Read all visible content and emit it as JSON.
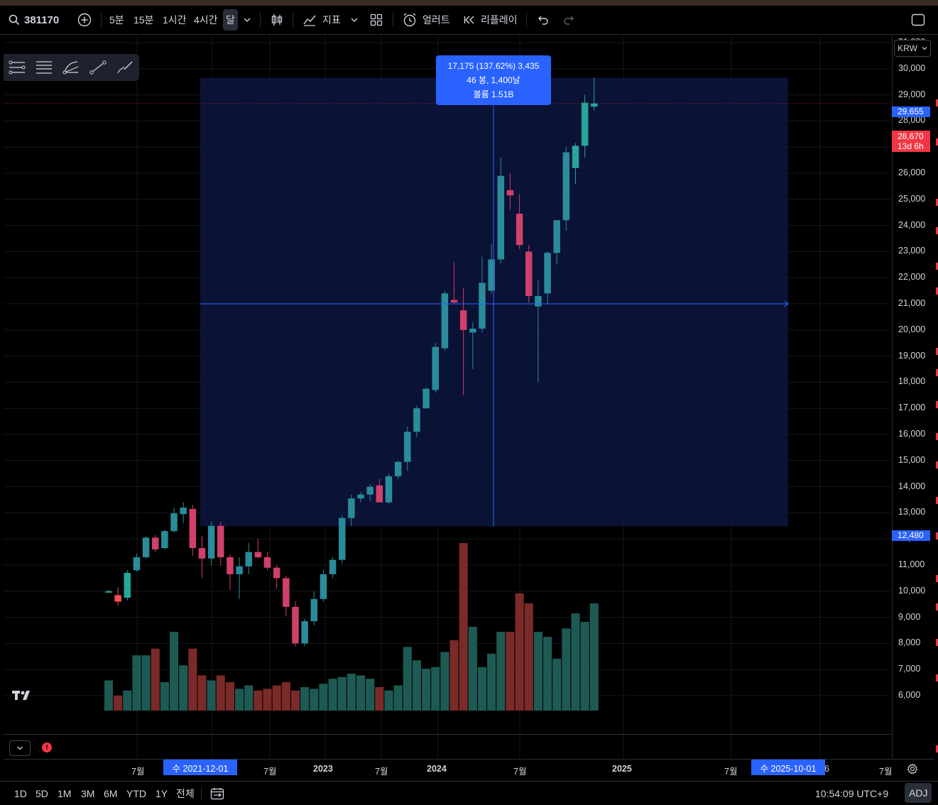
{
  "toolbar": {
    "symbol": "381170",
    "intervals": [
      "5분",
      "15분",
      "1시간",
      "4시간",
      "달"
    ],
    "active_interval": "달",
    "indicators_label": "지표",
    "alert_label": "얼러트",
    "replay_label": "리플레이"
  },
  "currency": "KRW",
  "measure_tooltip": {
    "line1": "17,175 (137.62%) 3,435",
    "line2": "46 봉, 1,400날",
    "line3": "볼륨 1.51B"
  },
  "price_axis": {
    "labels": [
      "31,000",
      "30,000",
      "29,000",
      "28,000",
      "27,000",
      "26,000",
      "25,000",
      "24,000",
      "23,000",
      "22,000",
      "21,000",
      "20,000",
      "19,000",
      "18,000",
      "17,000",
      "16,000",
      "15,000",
      "14,000",
      "13,000",
      "12,000",
      "11,000",
      "10,000",
      "9,000",
      "8,000",
      "7,000",
      "6,000"
    ],
    "high_tag": "29,655",
    "current_tag": "28,670",
    "countdown": "13d 6h",
    "low_tag": "12,480"
  },
  "time_axis": {
    "labels": [
      "7월",
      "7월",
      "2023",
      "7월",
      "2024",
      "7월",
      "2025",
      "7월",
      "6",
      "7월"
    ],
    "start_tag": "수 2021-12-01",
    "end_tag": "수 2025-10-01"
  },
  "bottom_bar": {
    "ranges": [
      "1D",
      "5D",
      "1M",
      "3M",
      "6M",
      "YTD",
      "1Y",
      "전체"
    ],
    "clock": "10:54:09 UTC+9",
    "adj_label": "ADJ"
  },
  "colors": {
    "up": "#26a69a",
    "down": "#ef5350",
    "selection": "#2962ff",
    "measure_fill": "#0c1540"
  },
  "chart_data": {
    "type": "candlestick",
    "interval": "1M",
    "x": [
      "2021-09",
      "2021-10",
      "2021-11",
      "2021-12",
      "2022-01",
      "2022-02",
      "2022-03",
      "2022-04",
      "2022-05",
      "2022-06",
      "2022-07",
      "2022-08",
      "2022-09",
      "2022-10",
      "2022-11",
      "2022-12",
      "2023-01",
      "2023-02",
      "2023-03",
      "2023-04",
      "2023-05",
      "2023-06",
      "2023-07",
      "2023-08",
      "2023-09",
      "2023-10",
      "2023-11",
      "2023-12",
      "2024-01",
      "2024-02",
      "2024-03",
      "2024-04",
      "2024-05",
      "2024-06",
      "2024-07",
      "2024-08",
      "2024-09",
      "2024-10",
      "2024-11",
      "2024-12",
      "2025-01",
      "2025-02",
      "2025-03",
      "2025-04",
      "2025-05",
      "2025-06",
      "2025-07",
      "2025-08",
      "2025-09",
      "2025-10"
    ],
    "ohlc": [
      [
        10000,
        10050,
        9950,
        10000
      ],
      [
        9850,
        10150,
        9450,
        9600
      ],
      [
        9750,
        10800,
        9650,
        10700
      ],
      [
        10800,
        11450,
        10750,
        11300
      ],
      [
        11300,
        12100,
        11250,
        12050
      ],
      [
        12050,
        12150,
        11500,
        11600
      ],
      [
        11650,
        12350,
        11600,
        12300
      ],
      [
        12300,
        13200,
        12250,
        12980
      ],
      [
        12950,
        13400,
        12600,
        13200
      ],
      [
        13150,
        13300,
        11350,
        11650
      ],
      [
        11650,
        12100,
        10500,
        11250
      ],
      [
        11250,
        12650,
        11000,
        12500
      ],
      [
        12500,
        12650,
        11000,
        11300
      ],
      [
        11300,
        11400,
        10050,
        10650
      ],
      [
        10650,
        11300,
        9700,
        10950
      ],
      [
        10950,
        11850,
        10650,
        11500
      ],
      [
        11500,
        12000,
        11250,
        11300
      ],
      [
        11300,
        11500,
        10800,
        10900
      ],
      [
        10900,
        11000,
        10100,
        10500
      ],
      [
        10500,
        10600,
        9050,
        9400
      ],
      [
        9400,
        9600,
        7900,
        8000
      ],
      [
        8000,
        8950,
        7900,
        8850
      ],
      [
        8850,
        10000,
        8700,
        9700
      ],
      [
        9700,
        10800,
        9600,
        10650
      ],
      [
        10650,
        11300,
        10500,
        11200
      ],
      [
        11200,
        12900,
        11050,
        12800
      ],
      [
        12800,
        13700,
        12500,
        13550
      ],
      [
        13550,
        13800,
        13400,
        13700
      ],
      [
        13700,
        14100,
        13450,
        14000
      ],
      [
        14050,
        14300,
        13400,
        13400
      ],
      [
        13400,
        14500,
        13350,
        14400
      ],
      [
        14400,
        15000,
        14300,
        14950
      ],
      [
        14950,
        16300,
        14600,
        16100
      ],
      [
        16100,
        17100,
        15900,
        17000
      ],
      [
        17000,
        17800,
        17000,
        17750
      ],
      [
        17700,
        19500,
        17600,
        19350
      ],
      [
        19300,
        21500,
        19200,
        21400
      ],
      [
        21150,
        22600,
        21000,
        21050
      ],
      [
        20750,
        21600,
        17500,
        20000
      ],
      [
        19900,
        20300,
        18500,
        20050
      ],
      [
        20050,
        22800,
        19900,
        21800
      ],
      [
        21500,
        23300,
        21400,
        22700
      ],
      [
        22700,
        26600,
        22550,
        25900
      ],
      [
        25350,
        26000,
        24600,
        25150
      ],
      [
        24450,
        25200,
        23100,
        23250
      ],
      [
        23000,
        23250,
        21050,
        21300
      ],
      [
        20900,
        21900,
        18000,
        21300
      ],
      [
        21400,
        23000,
        21000,
        22950
      ],
      [
        22950,
        24200,
        22500,
        24200
      ],
      [
        24200,
        27000,
        23800,
        26800
      ],
      [
        26200,
        27150,
        25600,
        27050
      ],
      [
        27050,
        29000,
        26600,
        28700
      ],
      [
        28550,
        29655,
        28400,
        28670
      ]
    ],
    "volume_relative": [
      0.18,
      0.09,
      0.12,
      0.33,
      0.33,
      0.37,
      0.17,
      0.47,
      0.27,
      0.37,
      0.21,
      0.18,
      0.21,
      0.17,
      0.13,
      0.15,
      0.12,
      0.13,
      0.15,
      0.17,
      0.12,
      0.14,
      0.13,
      0.16,
      0.19,
      0.2,
      0.22,
      0.21,
      0.19,
      0.14,
      0.12,
      0.15,
      0.38,
      0.3,
      0.25,
      0.26,
      0.35,
      0.42,
      1.0,
      0.5,
      0.26,
      0.34,
      0.47,
      0.47,
      0.7,
      0.64,
      0.47,
      0.44,
      0.31,
      0.49,
      0.58,
      0.53,
      0.64,
      0.2
    ],
    "measure": {
      "from_date": "2021-12-01",
      "to_date": "2025-10-01",
      "from_price": 12480,
      "to_price": 29655,
      "change": 17175,
      "change_pct": 137.62,
      "bars": 46,
      "days": 1400
    },
    "y_range": [
      5500,
      31500
    ]
  }
}
